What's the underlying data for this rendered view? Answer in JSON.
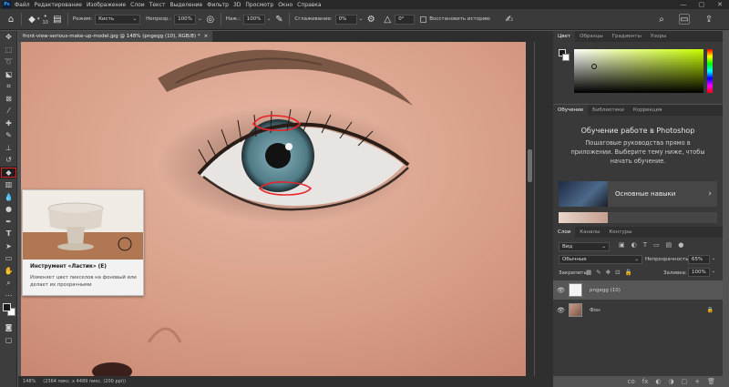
{
  "menubar": {
    "logo": "Ps",
    "items": [
      "Файл",
      "Редактирование",
      "Изображение",
      "Слои",
      "Текст",
      "Выделение",
      "Фильтр",
      "3D",
      "Просмотр",
      "Окно",
      "Справка"
    ],
    "window_controls": [
      "—",
      "▢",
      "✕"
    ]
  },
  "options": {
    "brush_size": "10",
    "mode_label": "Режим:",
    "mode_value": "Кисть",
    "opacity_label": "Непрозр.:",
    "opacity_value": "100%",
    "flow_label": "Наж.:",
    "flow_value": "100%",
    "smoothing_label": "Сглаживание:",
    "smoothing_value": "0%",
    "angle_value": "0°",
    "history_label": "Восстановить историю"
  },
  "document": {
    "tab_title": "front-view-serious-make-up-model.jpg @ 148% (pngegg (10), RGB/8) *",
    "close": "×"
  },
  "status": {
    "zoom": "148%",
    "size": "(2364 пикс. x 4489 пикс. (200 ppi))"
  },
  "tooltip": {
    "title": "Инструмент «Ластик» (E)",
    "description": "Изменяет цвет пикселов на фоновый или делает их прозрачными"
  },
  "color_panel": {
    "tabs": [
      "Цвет",
      "Образцы",
      "Градиенты",
      "Узоры"
    ]
  },
  "learn_panel": {
    "tabs": [
      "Обучение",
      "Библиотеки",
      "Коррекция"
    ],
    "title": "Обучение работе в Photoshop",
    "subtitle": "Пошаговые руководства прямо в приложении. Выберите тему ниже, чтобы начать обучение.",
    "card_label": "Основные навыки"
  },
  "layers_panel": {
    "tabs": [
      "Слои",
      "Каналы",
      "Контуры"
    ],
    "filter_value": "Вид",
    "blend_mode": "Обычные",
    "opacity_label": "Непрозрачность:",
    "opacity_value": "65%",
    "lock_label": "Закрепить:",
    "fill_label": "Заливка:",
    "fill_value": "100%",
    "layers": [
      {
        "name": "pngegg (10)"
      },
      {
        "name": "Фон"
      }
    ],
    "bottom_icons": [
      "co",
      "fx",
      "◐",
      "◑",
      "▢",
      "+",
      "🗑"
    ]
  },
  "colors": {
    "accent_red": "#e02424",
    "annotation_red": "#e8242b"
  }
}
